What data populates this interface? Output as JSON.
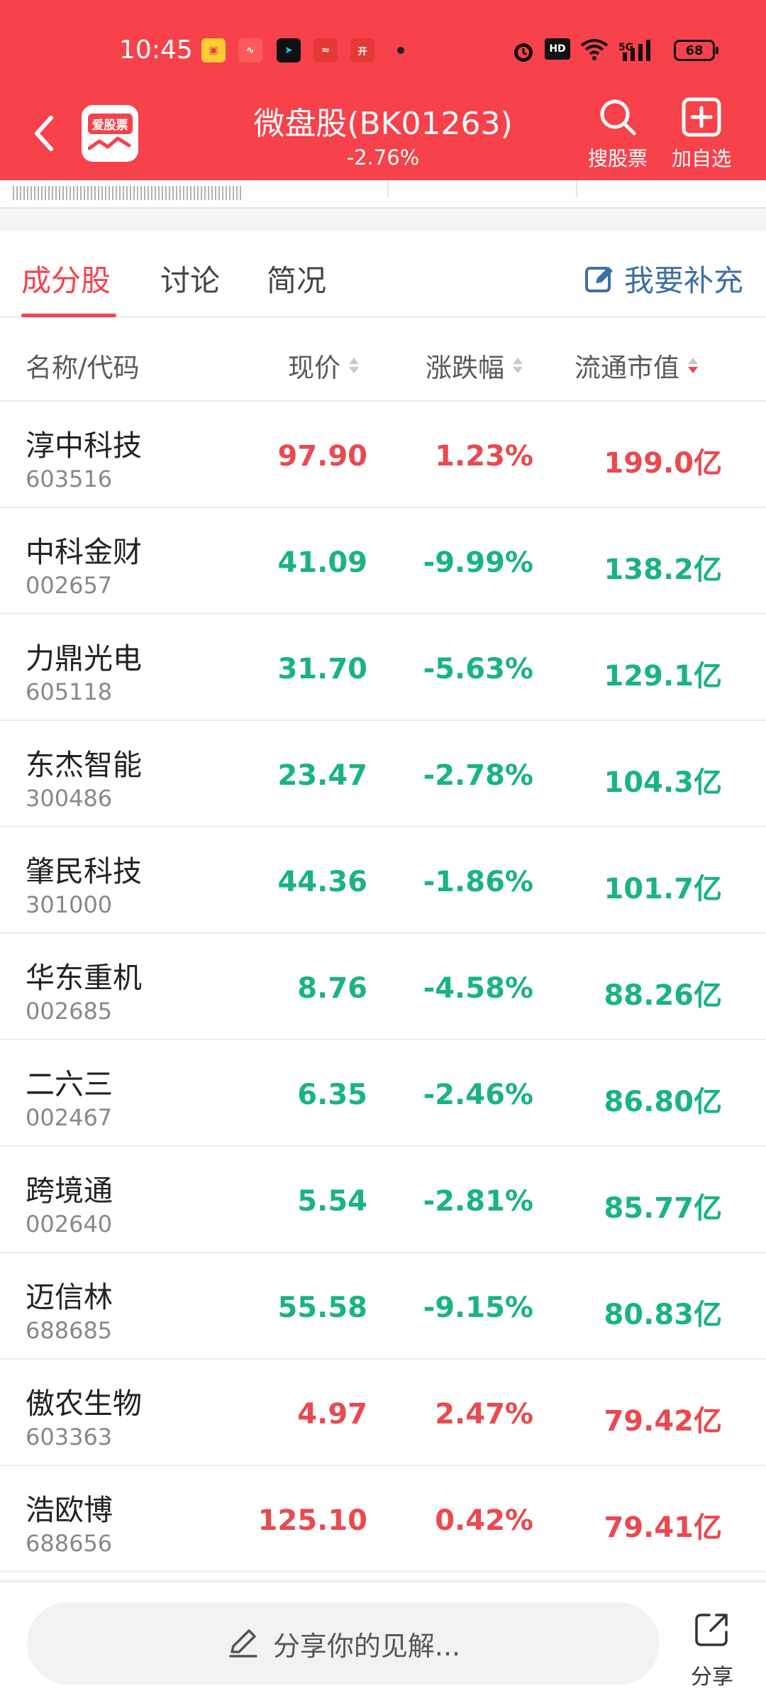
{
  "status_bar": {
    "time": "10:45",
    "app_icons": [
      "红包",
      "行情",
      "投资",
      "爱股票",
      "开盘"
    ],
    "network": "5G",
    "hd": "HD",
    "battery": "68"
  },
  "header": {
    "logo_text": "爱股票",
    "title": "微盘股(BK01263)",
    "change": "-2.76%",
    "search_label": "搜股票",
    "add_label": "加自选"
  },
  "tabs": [
    {
      "label": "成分股"
    },
    {
      "label": "讨论"
    },
    {
      "label": "简况"
    }
  ],
  "contribute_label": "我要补充",
  "table": {
    "headers": {
      "name": "名称/代码",
      "price": "现价",
      "change": "涨跌幅",
      "cap": "流通市值"
    },
    "rows": [
      {
        "name": "淳中科技",
        "code": "603516",
        "price": "97.90",
        "change": "1.23%",
        "cap": "199.0亿",
        "trend": "up"
      },
      {
        "name": "中科金财",
        "code": "002657",
        "price": "41.09",
        "change": "-9.99%",
        "cap": "138.2亿",
        "trend": "down"
      },
      {
        "name": "力鼎光电",
        "code": "605118",
        "price": "31.70",
        "change": "-5.63%",
        "cap": "129.1亿",
        "trend": "down"
      },
      {
        "name": "东杰智能",
        "code": "300486",
        "price": "23.47",
        "change": "-2.78%",
        "cap": "104.3亿",
        "trend": "down"
      },
      {
        "name": "肇民科技",
        "code": "301000",
        "price": "44.36",
        "change": "-1.86%",
        "cap": "101.7亿",
        "trend": "down"
      },
      {
        "name": "华东重机",
        "code": "002685",
        "price": "8.76",
        "change": "-4.58%",
        "cap": "88.26亿",
        "trend": "down"
      },
      {
        "name": "二六三",
        "code": "002467",
        "price": "6.35",
        "change": "-2.46%",
        "cap": "86.80亿",
        "trend": "down"
      },
      {
        "name": "跨境通",
        "code": "002640",
        "price": "5.54",
        "change": "-2.81%",
        "cap": "85.77亿",
        "trend": "down"
      },
      {
        "name": "迈信林",
        "code": "688685",
        "price": "55.58",
        "change": "-9.15%",
        "cap": "80.83亿",
        "trend": "down"
      },
      {
        "name": "傲农生物",
        "code": "603363",
        "price": "4.97",
        "change": "2.47%",
        "cap": "79.42亿",
        "trend": "up"
      },
      {
        "name": "浩欧博",
        "code": "688656",
        "price": "125.10",
        "change": "0.42%",
        "cap": "79.41亿",
        "trend": "up"
      }
    ]
  },
  "bottom": {
    "comment_placeholder": "分享你的见解...",
    "share_label": "分享"
  },
  "colors": {
    "brand": "#f7414b",
    "up": "#e84a4f",
    "down": "#19b47f",
    "link": "#3c6fa5"
  }
}
